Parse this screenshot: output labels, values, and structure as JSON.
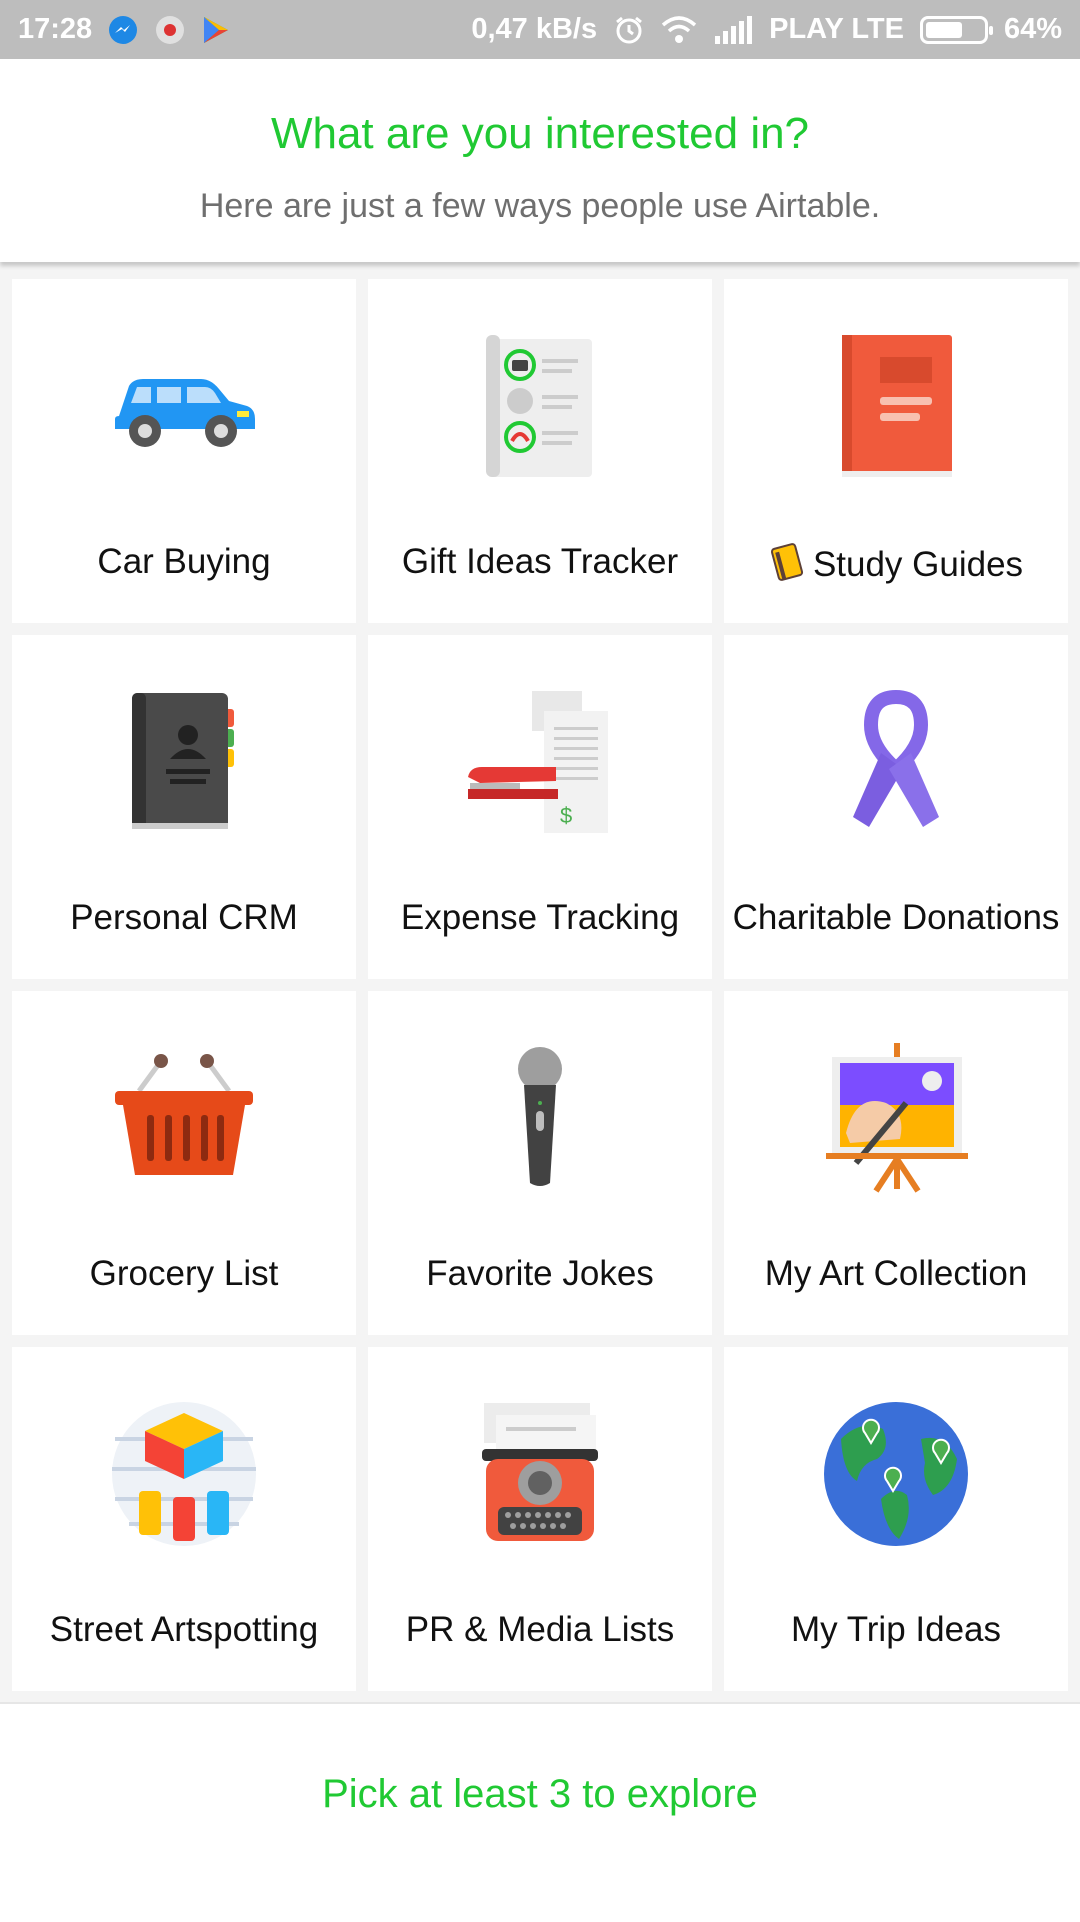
{
  "status_bar": {
    "time": "17:28",
    "speed": "0,47 kB/s",
    "carrier": "PLAY LTE",
    "battery": "64%",
    "battery_level": 0.64,
    "left_icons": [
      "messenger-icon",
      "notification-icon",
      "play-store-icon"
    ],
    "right_icons": [
      "alarm-icon",
      "wifi-icon",
      "signal-icon",
      "battery-icon"
    ]
  },
  "header": {
    "title": "What are you interested in?",
    "subtitle": "Here are just a few ways people use Airtable."
  },
  "cards": [
    {
      "label": "Car Buying",
      "icon": "car-icon"
    },
    {
      "label": "Gift Ideas Tracker",
      "icon": "gift-list-icon"
    },
    {
      "label": "Study Guides",
      "icon": "book-icon",
      "label_emoji": "notebook-emoji-icon"
    },
    {
      "label": "Personal CRM",
      "icon": "address-book-icon"
    },
    {
      "label": "Expense Tracking",
      "icon": "stapler-receipt-icon"
    },
    {
      "label": "Charitable Donations",
      "icon": "ribbon-icon"
    },
    {
      "label": "Grocery List",
      "icon": "basket-icon"
    },
    {
      "label": "Favorite Jokes",
      "icon": "microphone-icon"
    },
    {
      "label": "My Art Collection",
      "icon": "easel-painting-icon"
    },
    {
      "label": "Street Artspotting",
      "icon": "spray-paint-icon"
    },
    {
      "label": "PR & Media Lists",
      "icon": "typewriter-icon"
    },
    {
      "label": "My Trip Ideas",
      "icon": "globe-icon"
    }
  ],
  "footer": {
    "cta": "Pick at least 3 to explore"
  },
  "colors": {
    "accent": "#20c933",
    "status_bar": "#bdbdbd"
  }
}
